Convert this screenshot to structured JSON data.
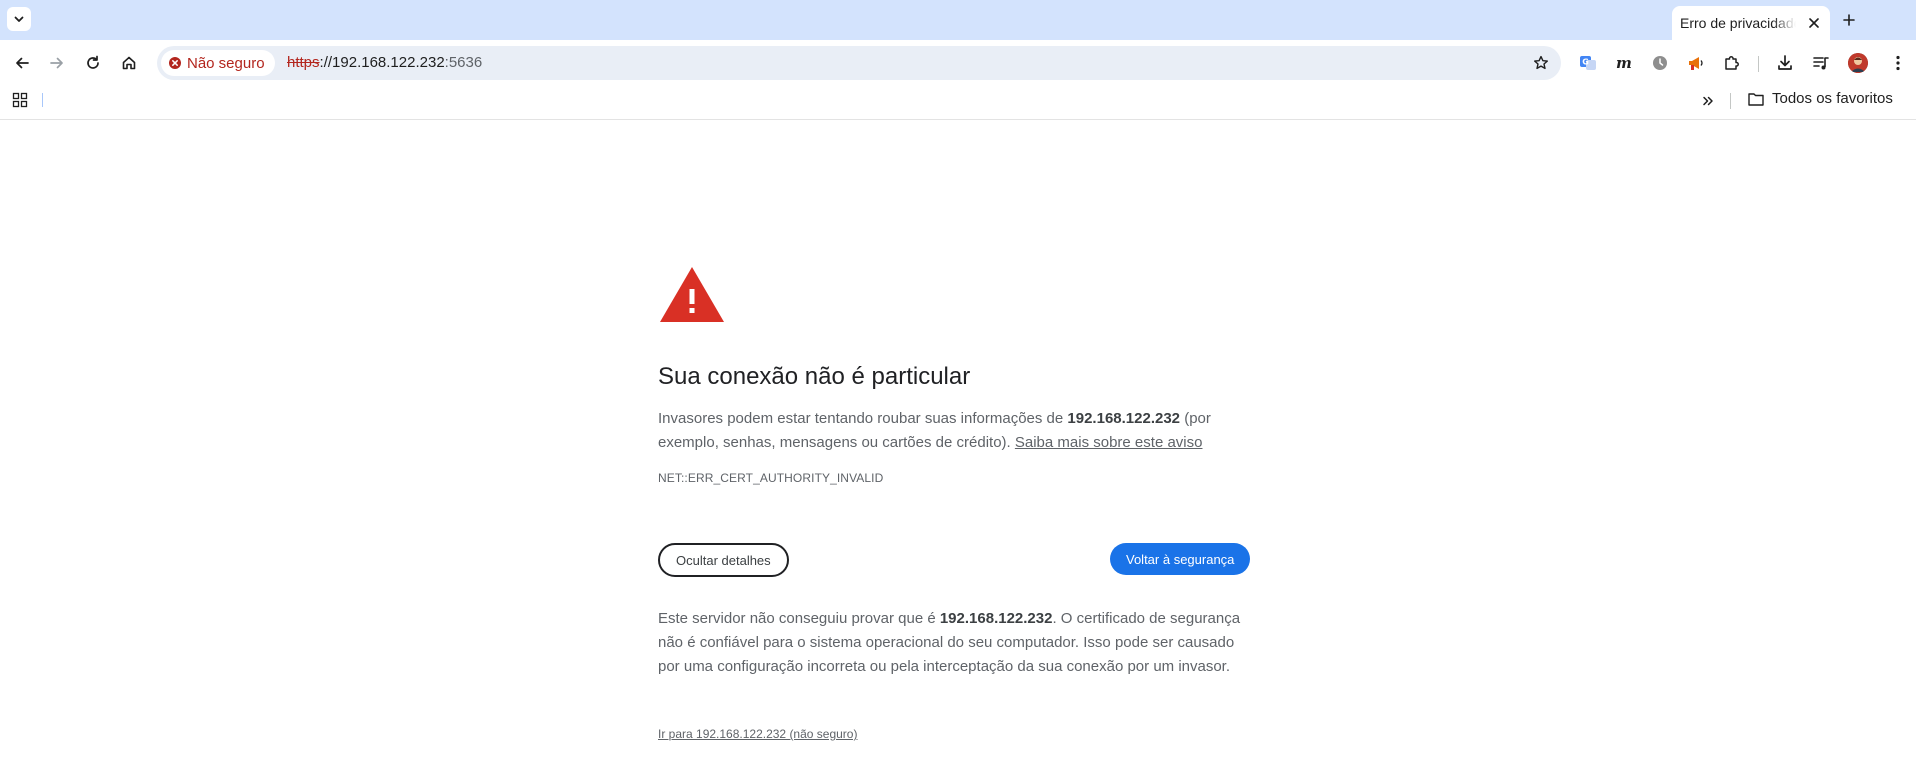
{
  "tabstrip": {
    "active_tab_title": "Erro de privacidade"
  },
  "toolbar": {
    "security_label": "Não seguro",
    "url": {
      "scheme": "https",
      "separator": "://",
      "host": "192.168.122.232",
      "port": ":5636"
    }
  },
  "bookmarks": {
    "all_bookmarks_label": "Todos os favoritos"
  },
  "interstitial": {
    "title": "Sua conexão não é particular",
    "p1_prefix": "Invasores podem estar tentando roubar suas informações de ",
    "p1_host": "192.168.122.232",
    "p1_suffix": " (por exemplo, senhas, mensagens ou cartões de crédito). ",
    "learn_more": "Saiba mais sobre este aviso",
    "error_code": "NET::ERR_CERT_AUTHORITY_INVALID",
    "hide_details": "Ocultar detalhes",
    "back_to_safety": "Voltar à segurança",
    "p2_prefix": "Este servidor não conseguiu provar que é ",
    "p2_host": "192.168.122.232",
    "p2_suffix": ". O certificado de segurança não é confiável para o sistema operacional do seu computador. Isso pode ser causado por uma configuração incorreta ou pela interceptação da sua conexão por um invasor.",
    "proceed_link": "Ir para 192.168.122.232 (não seguro)"
  },
  "colors": {
    "tabstrip_bg": "#d3e3fd",
    "omnibox_bg": "#e9eef6",
    "insecure_red": "#b3261e",
    "warning_red": "#d93025",
    "primary_blue": "#1a73e8"
  }
}
